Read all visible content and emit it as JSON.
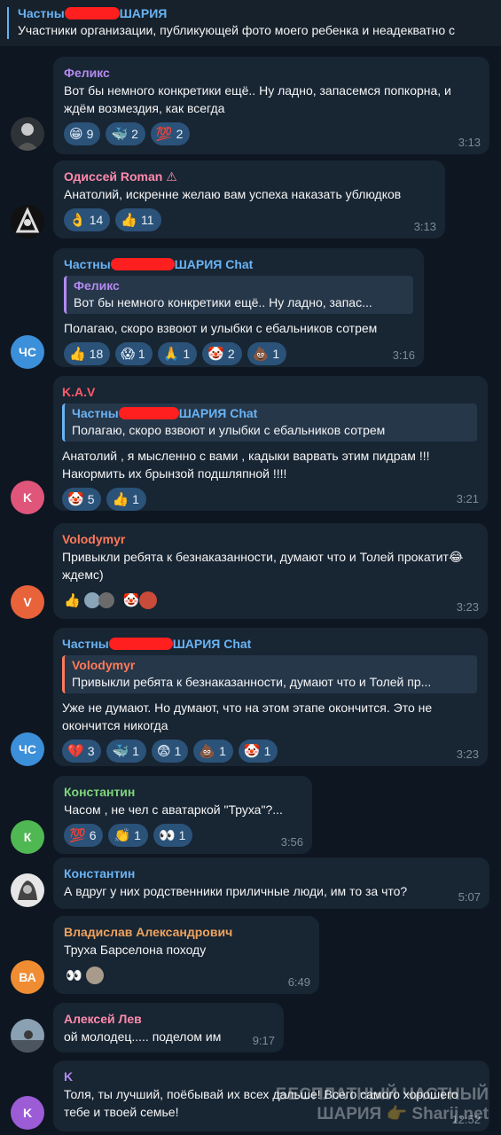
{
  "pinned": {
    "title_left": "Частны",
    "title_right": "ШАРИЯ",
    "text": "Участники организации, публикующей фото моего ребенка и неадекватно с"
  },
  "messages": [
    {
      "name": "Феликс",
      "name_color": "#b38aef",
      "avatar_text": "",
      "avatar_color": "#3a3f44",
      "text": "Вот бы немного конкретики ещё.. Ну ладно, запасемся попкорна, и ждём возмездия, как всегда",
      "reactions": [
        {
          "e": "😁",
          "n": "9"
        },
        {
          "e": "🐳",
          "n": "2"
        },
        {
          "e": "💯",
          "n": "2"
        }
      ],
      "time": "3:13"
    },
    {
      "name": "Одиссей Roman",
      "name_color": "#ff8aac",
      "avatar_text": "",
      "avatar_color": "#1e1e1e",
      "text": "Анатолий, искренне желаю вам успеха наказать ублюдков",
      "reactions": [
        {
          "e": "👌",
          "n": "14"
        },
        {
          "e": "👍",
          "n": "11"
        }
      ],
      "time": "3:13"
    },
    {
      "name_left": "Частны",
      "name_right": "ШАРИЯ Chat",
      "name_color": "#6ab3f3",
      "avatar_text": "ЧС",
      "avatar_color": "#3c8fd9",
      "reply_name": "Феликс",
      "reply_color": "#b38aef",
      "reply_text": "Вот бы немного конкретики ещё.. Ну ладно, запас...",
      "text": "Полагаю, скоро взвоют и улыбки с ебальников сотрем",
      "reactions": [
        {
          "e": "👍",
          "n": "18"
        },
        {
          "e": "😱",
          "n": "1"
        },
        {
          "e": "🙏",
          "n": "1"
        },
        {
          "e": "🤡",
          "n": "2"
        },
        {
          "e": "💩",
          "n": "1"
        }
      ],
      "time": "3:16"
    },
    {
      "name": "K.A.V",
      "name_color": "#ff5b6b",
      "avatar_text": "K",
      "avatar_color": "#e0557a",
      "reply_left": "Частны",
      "reply_right": "ШАРИЯ Chat",
      "reply_color": "#6ab3f3",
      "reply_text": "Полагаю, скоро взвоют и улыбки с ебальников сотрем",
      "text": "Анатолий , я мысленно с вами , кадыки варвать этим пидрам !!!\nНакормить их брынзой подшляпной !!!!",
      "reactions": [
        {
          "e": "🤡",
          "n": "5"
        },
        {
          "e": "👍",
          "n": "1"
        }
      ],
      "time": "3:21"
    },
    {
      "name": "Volodymyr",
      "name_color": "#ff7a59",
      "avatar_text": "V",
      "avatar_color": "#e8623a",
      "text": "Привыкли ребята к безнаказанности, думают что и Толей прокатит😂 ждемс)",
      "reactions": [
        {
          "e": "👍",
          "n": ""
        },
        {
          "e": "🤡",
          "n": ""
        }
      ],
      "time": "3:23"
    },
    {
      "name_left": "Частны",
      "name_right": "ШАРИЯ Chat",
      "name_color": "#6ab3f3",
      "avatar_text": "ЧС",
      "avatar_color": "#3c8fd9",
      "reply_name": "Volodymyr",
      "reply_color": "#ff7a59",
      "reply_text": "Привыкли ребята к безнаказанности, думают что и Толей пр...",
      "text": "Уже не думают. Но думают, что на этом этапе окончится. Это не окончится никогда",
      "reactions": [
        {
          "e": "💔",
          "n": "3"
        },
        {
          "e": "🐳",
          "n": "1"
        },
        {
          "e": "😨",
          "n": "1"
        },
        {
          "e": "💩",
          "n": "1"
        },
        {
          "e": "🤡",
          "n": "1"
        }
      ],
      "time": "3:23"
    },
    {
      "name": "Константин",
      "name_color": "#7fd67a",
      "avatar_text": "К",
      "avatar_color": "#4fb853",
      "text": "Часом , не чел с аватаркой \"Труха\"?...",
      "reactions": [
        {
          "e": "💯",
          "n": "6"
        },
        {
          "e": "👏",
          "n": "1"
        },
        {
          "e": "👀",
          "n": "1"
        }
      ],
      "time": "3:56"
    },
    {
      "name": "Константин",
      "name_color": "#6ab3f3",
      "avatar_text": "",
      "avatar_color": "#d8d8d8",
      "text": "А вдруг у них родственники приличные люди, им то за что?",
      "reactions": [],
      "time": "5:07"
    },
    {
      "name": "Владислав Александрович",
      "name_color": "#f0a35c",
      "avatar_text": "ВА",
      "avatar_color": "#f08d33",
      "text": "Труха Барселона походу",
      "reactions": [
        {
          "e": "👀",
          "n": ""
        }
      ],
      "time": "6:49"
    },
    {
      "name": "Алексей Лев",
      "name_color": "#ff8aac",
      "avatar_text": "",
      "avatar_color": "#6b7a88",
      "text": "ой молодец..... поделом им",
      "reactions": [],
      "time": "9:17"
    },
    {
      "name": "K",
      "name_color": "#b38aef",
      "avatar_text": "K",
      "avatar_color": "#9b5cd6",
      "text": "Толя, ты лучший, поёбывай их всех дальше! Всего самого хорошего тебе и твоей семье!",
      "reactions": [],
      "time": "12:52"
    }
  ],
  "watermark": {
    "line1": "БЕСПЛАТНЫЙ ЧАСТНЫЙ",
    "line2": "ШАРИЯ 👉 Sharij.net"
  }
}
